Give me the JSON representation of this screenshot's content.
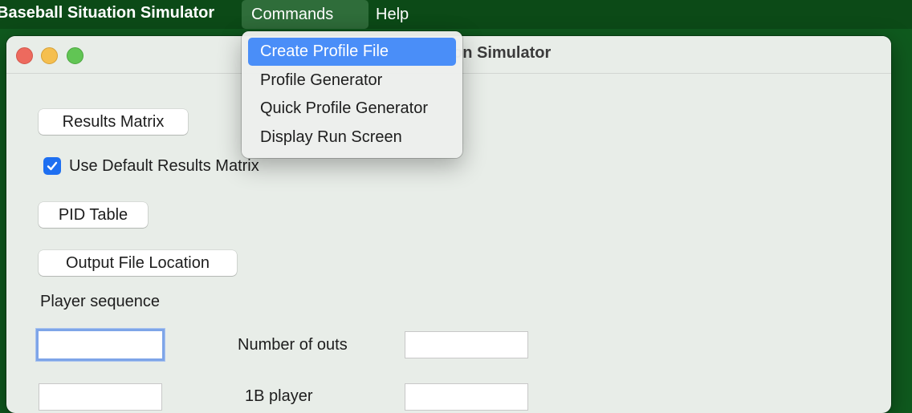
{
  "menubar": {
    "app_name": "Baseball Situation Simulator",
    "menus": [
      "Commands",
      "Help"
    ]
  },
  "window": {
    "title": "Baseball Situation Simulator",
    "title_visible": "on Simulator"
  },
  "dropdown": {
    "items": [
      "Create Profile File",
      "Profile Generator",
      "Quick Profile Generator",
      "Display Run Screen"
    ],
    "selected_index": 0
  },
  "form": {
    "results_matrix_button": "Results Matrix",
    "use_default_checkbox": {
      "label": "Use Default Results Matrix",
      "checked": true
    },
    "pid_table_button": "PID Table",
    "output_file_button": "Output File Location",
    "player_sequence_label": "Player sequence",
    "number_of_outs_label": "Number of outs",
    "first_base_label": "1B player",
    "player_sequence_value": "",
    "number_of_outs_value": "",
    "first_base_value": "",
    "row2_left_value": ""
  }
}
